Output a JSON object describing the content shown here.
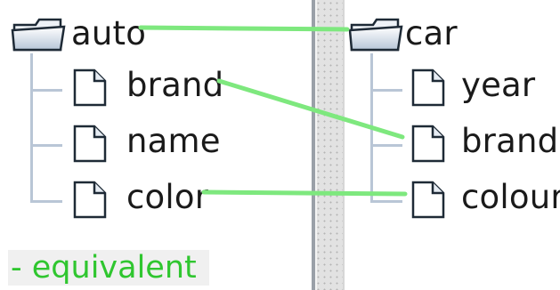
{
  "left_tree": {
    "root": {
      "label": "auto",
      "icon": "folder-icon"
    },
    "children": [
      {
        "label": "brand",
        "icon": "file-icon"
      },
      {
        "label": "name",
        "icon": "file-icon"
      },
      {
        "label": "color",
        "icon": "file-icon"
      }
    ]
  },
  "right_tree": {
    "root": {
      "label": "car",
      "icon": "folder-icon"
    },
    "children": [
      {
        "label": "year",
        "icon": "file-icon"
      },
      {
        "label": "brand",
        "icon": "file-icon"
      },
      {
        "label": "colour",
        "icon": "file-icon"
      }
    ]
  },
  "mappings": [
    {
      "from": "auto",
      "to": "car",
      "relation": "equivalent"
    },
    {
      "from": "brand",
      "to": "brand",
      "relation": "equivalent"
    },
    {
      "from": "color",
      "to": "colour",
      "relation": "equivalent"
    }
  ],
  "legend": {
    "label": "- equivalent",
    "color": "#7ee87e"
  },
  "colors": {
    "mapping_line": "#7ee87e",
    "tree_connector": "#b9c6d6",
    "legend_text": "#2fc62f"
  }
}
